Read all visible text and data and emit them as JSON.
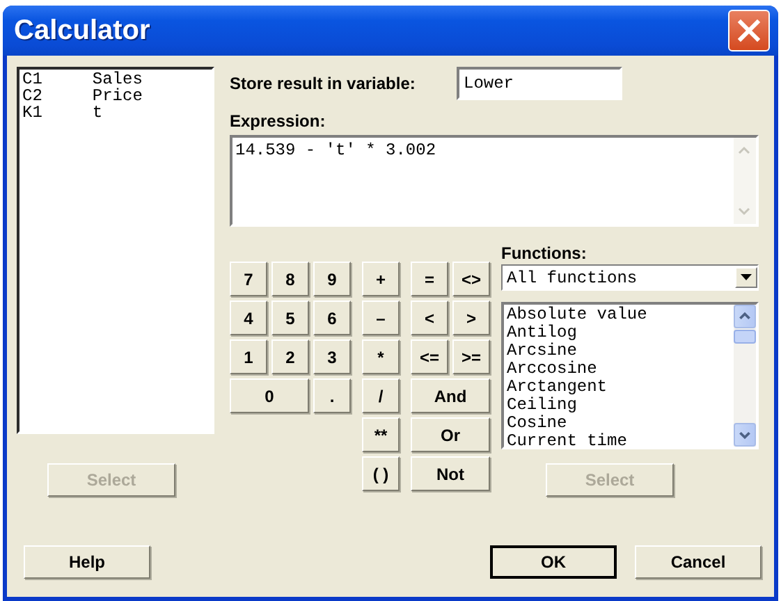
{
  "window": {
    "title": "Calculator"
  },
  "variables": {
    "items": [
      {
        "column": "C1",
        "name": "Sales",
        "selected": false
      },
      {
        "column": "C2",
        "name": "Price",
        "selected": false
      },
      {
        "column": "K1",
        "name": "t",
        "selected": false
      }
    ],
    "select_button": {
      "label": "Select",
      "disabled": true
    }
  },
  "store_result": {
    "label": "Store result in variable:",
    "value": "Lower"
  },
  "expression": {
    "label": "Expression:",
    "value": "14.539 - 't' * 3.002"
  },
  "keypad": [
    "7",
    "8",
    "9",
    "+",
    "=",
    "<>",
    "4",
    "5",
    "6",
    "–",
    "<",
    ">",
    "1",
    "2",
    "3",
    "*",
    "<=",
    ">=",
    "0",
    ".",
    "/",
    "And",
    "**",
    "Or",
    "( )",
    "Not"
  ],
  "functions": {
    "label": "Functions:",
    "filter": "All functions",
    "items": [
      {
        "label": "Absolute value",
        "selected": false
      },
      {
        "label": "Antilog",
        "selected": false
      },
      {
        "label": "Arcsine",
        "selected": false
      },
      {
        "label": "Arccosine",
        "selected": false
      },
      {
        "label": "Arctangent",
        "selected": false
      },
      {
        "label": "Ceiling",
        "selected": false
      },
      {
        "label": "Cosine",
        "selected": false
      },
      {
        "label": "Current time",
        "selected": false
      }
    ],
    "select_button": {
      "label": "Select",
      "disabled": true
    }
  },
  "buttons": [
    {
      "label": "Help",
      "default": false
    },
    {
      "label": "OK",
      "default": true
    },
    {
      "label": "Cancel",
      "default": false
    }
  ]
}
